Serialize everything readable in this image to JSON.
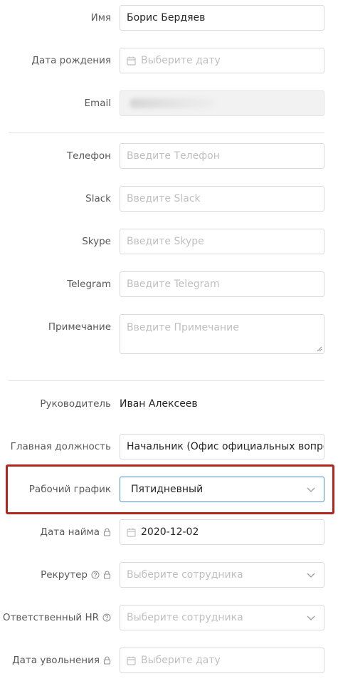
{
  "fields": {
    "name": {
      "label": "Имя",
      "value": "Борис Бердяев"
    },
    "birthdate": {
      "label": "Дата рождения",
      "placeholder": "Выберите дату"
    },
    "email": {
      "label": "Email"
    },
    "phone": {
      "label": "Телефон",
      "placeholder": "Введите Телефон"
    },
    "slack": {
      "label": "Slack",
      "placeholder": "Введите Slack"
    },
    "skype": {
      "label": "Skype",
      "placeholder": "Введите Skype"
    },
    "telegram": {
      "label": "Telegram",
      "placeholder": "Введите Telegram"
    },
    "note": {
      "label": "Примечание",
      "placeholder": "Введите Примечание"
    },
    "manager": {
      "label": "Руководитель",
      "value": "Иван Алексеев"
    },
    "main_position": {
      "label": "Главная должность",
      "value": "Начальник (Офис официальных вопросов)"
    },
    "schedule": {
      "label": "Рабочий график",
      "value": "Пятидневный"
    },
    "hire_date": {
      "label": "Дата найма",
      "value": "2020-12-02"
    },
    "recruiter": {
      "label": "Рекрутер",
      "placeholder": "Выберите сотрудника"
    },
    "hr": {
      "label": "Ответственный HR",
      "placeholder": "Выберите сотрудника"
    },
    "dismissal_date": {
      "label": "Дата увольнения",
      "placeholder": "Выберите дату"
    }
  },
  "icons": {
    "calendar": "calendar-icon",
    "chevron": "chevron-down-icon",
    "lock": "lock-icon",
    "help": "question-circle-icon"
  },
  "colors": {
    "highlight": "#b3261e",
    "focus_border": "#4a90d9",
    "border": "#d9d9d9",
    "placeholder": "#bfbfbf",
    "label": "#595959"
  }
}
